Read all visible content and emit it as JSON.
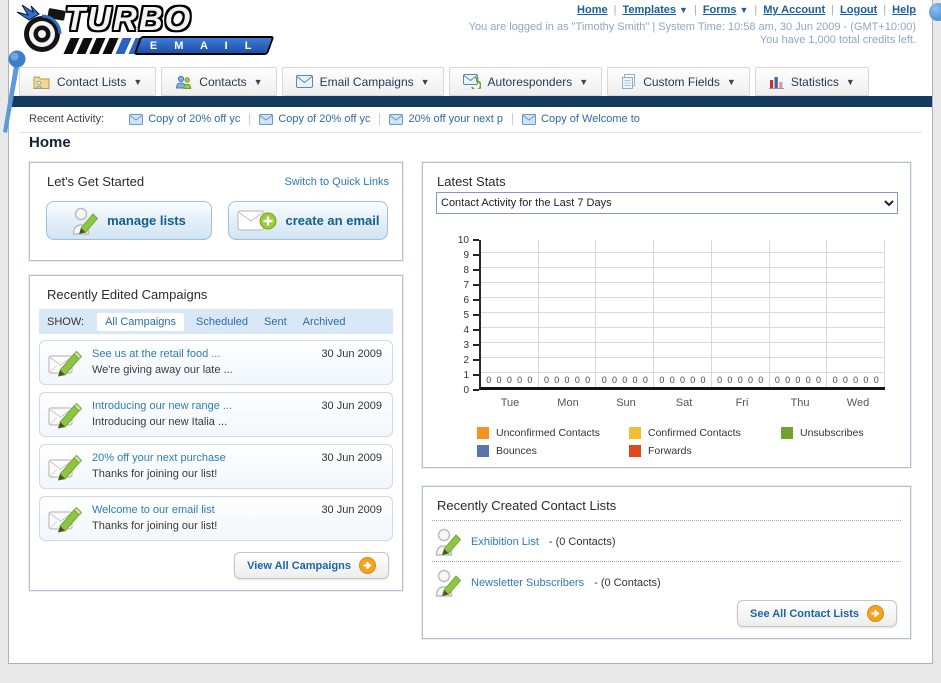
{
  "header": {
    "logo": {
      "title": "TURBO",
      "subtitle": "E M A I L"
    },
    "nav": [
      {
        "label": "Home",
        "dropdown": false
      },
      {
        "label": "Templates",
        "dropdown": true
      },
      {
        "label": "Forms",
        "dropdown": true
      },
      {
        "label": "My Account",
        "dropdown": false
      },
      {
        "label": "Logout",
        "dropdown": false
      },
      {
        "label": "Help",
        "dropdown": false
      }
    ],
    "login_line1": "You are logged in as \"Timothy Smith\" | System Time: 10:58 am, 30 Jun 2009 - (GMT+10:00)",
    "login_line2": "You have 1,000 total credits left."
  },
  "tabs": [
    {
      "label": "Contact Lists",
      "icon": "folder-contacts-icon"
    },
    {
      "label": "Contacts",
      "icon": "people-icon"
    },
    {
      "label": "Email Campaigns",
      "icon": "envelope-icon"
    },
    {
      "label": "Autoresponders",
      "icon": "envelope-arrow-icon"
    },
    {
      "label": "Custom Fields",
      "icon": "pages-icon"
    },
    {
      "label": "Statistics",
      "icon": "bar-chart-icon"
    }
  ],
  "colors": {
    "navy_bar": "#143a5f",
    "link_blue": "#2a6ca8",
    "accent_orange": "#f6a21d"
  },
  "recent_activity": {
    "label": "Recent Activity:",
    "items": [
      "Copy of 20% off yc",
      "Copy of 20% off yc",
      "20% off your next p",
      "Copy of Welcome to"
    ]
  },
  "page_title": "Home",
  "get_started": {
    "title": "Let's Get Started",
    "switch_link": "Switch to Quick Links",
    "manage_label": "manage lists",
    "create_label": "create an email"
  },
  "campaigns": {
    "title": "Recently Edited Campaigns",
    "show_label": "SHOW:",
    "filters": [
      "All Campaigns",
      "Scheduled",
      "Sent",
      "Archived"
    ],
    "active_filter": "All Campaigns",
    "items": [
      {
        "title": "See us at the retail food ...",
        "subtitle": "We're giving away our late ...",
        "date": "30 Jun 2009"
      },
      {
        "title": "Introducing our new range ...",
        "subtitle": "Introducing our new Italia ...",
        "date": "30 Jun 2009"
      },
      {
        "title": "20% off your next purchase",
        "subtitle": "Thanks for joining our list!",
        "date": "30 Jun 2009"
      },
      {
        "title": "Welcome to our email list",
        "subtitle": "Thanks for joining our list!",
        "date": "30 Jun 2009"
      }
    ],
    "view_all": "View All Campaigns"
  },
  "stats": {
    "title": "Latest Stats",
    "dropdown_value": "Contact Activity for the Last 7 Days"
  },
  "chart_data": {
    "type": "bar",
    "title": "Contact Activity for the Last 7 Days",
    "categories": [
      "Tue",
      "Mon",
      "Sun",
      "Sat",
      "Fri",
      "Thu",
      "Wed"
    ],
    "series": [
      {
        "name": "Unconfirmed Contacts",
        "color": "#f79122",
        "values": [
          0,
          0,
          0,
          0,
          0,
          0,
          0
        ]
      },
      {
        "name": "Confirmed Contacts",
        "color": "#f2c02e",
        "values": [
          0,
          0,
          0,
          0,
          0,
          0,
          0
        ]
      },
      {
        "name": "Unsubscribes",
        "color": "#72a22e",
        "values": [
          0,
          0,
          0,
          0,
          0,
          0,
          0
        ]
      },
      {
        "name": "Bounces",
        "color": "#5876ab",
        "values": [
          0,
          0,
          0,
          0,
          0,
          0,
          0
        ]
      },
      {
        "name": "Forwards",
        "color": "#e0491f",
        "values": [
          0,
          0,
          0,
          0,
          0,
          0,
          0
        ]
      }
    ],
    "xlabel": "",
    "ylabel": "",
    "ylim": [
      0,
      10
    ],
    "yticks": [
      0,
      1,
      2,
      3,
      4,
      5,
      6,
      7,
      8,
      9,
      10
    ],
    "grid": true,
    "legend_position": "bottom"
  },
  "contact_lists": {
    "title": "Recently Created Contact Lists",
    "items": [
      {
        "name": "Exhibition List",
        "detail": "- (0 Contacts)"
      },
      {
        "name": "Newsletter Subscribers",
        "detail": "- (0 Contacts)"
      }
    ],
    "see_all": "See All Contact Lists"
  }
}
